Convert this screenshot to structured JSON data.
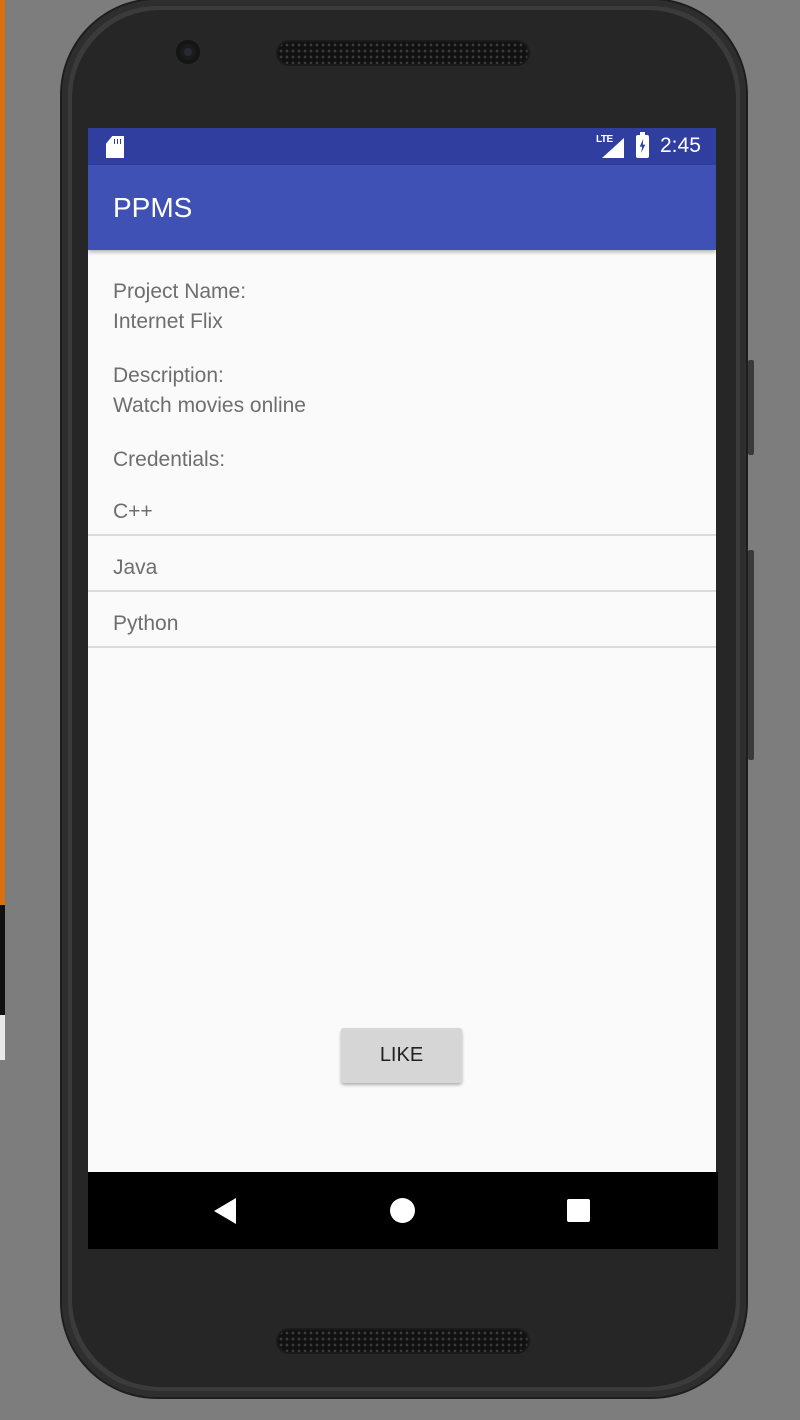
{
  "status_bar": {
    "network_label": "LTE",
    "time": "2:45",
    "icons": [
      "sd-card-icon",
      "signal-icon",
      "battery-charging-icon"
    ]
  },
  "app_bar": {
    "title": "PPMS",
    "color": "#3f51b5",
    "status_color": "#303f9f"
  },
  "project": {
    "name_label": "Project Name:",
    "name_value": "Internet Flix",
    "description_label": "Description:",
    "description_value": "Watch movies online",
    "credentials_label": "Credentials:",
    "credentials": [
      "C++",
      "Java",
      "Python"
    ]
  },
  "actions": {
    "like_label": "LIKE"
  },
  "nav_bar": {
    "icons": [
      "back-icon",
      "home-icon",
      "recents-icon"
    ]
  }
}
